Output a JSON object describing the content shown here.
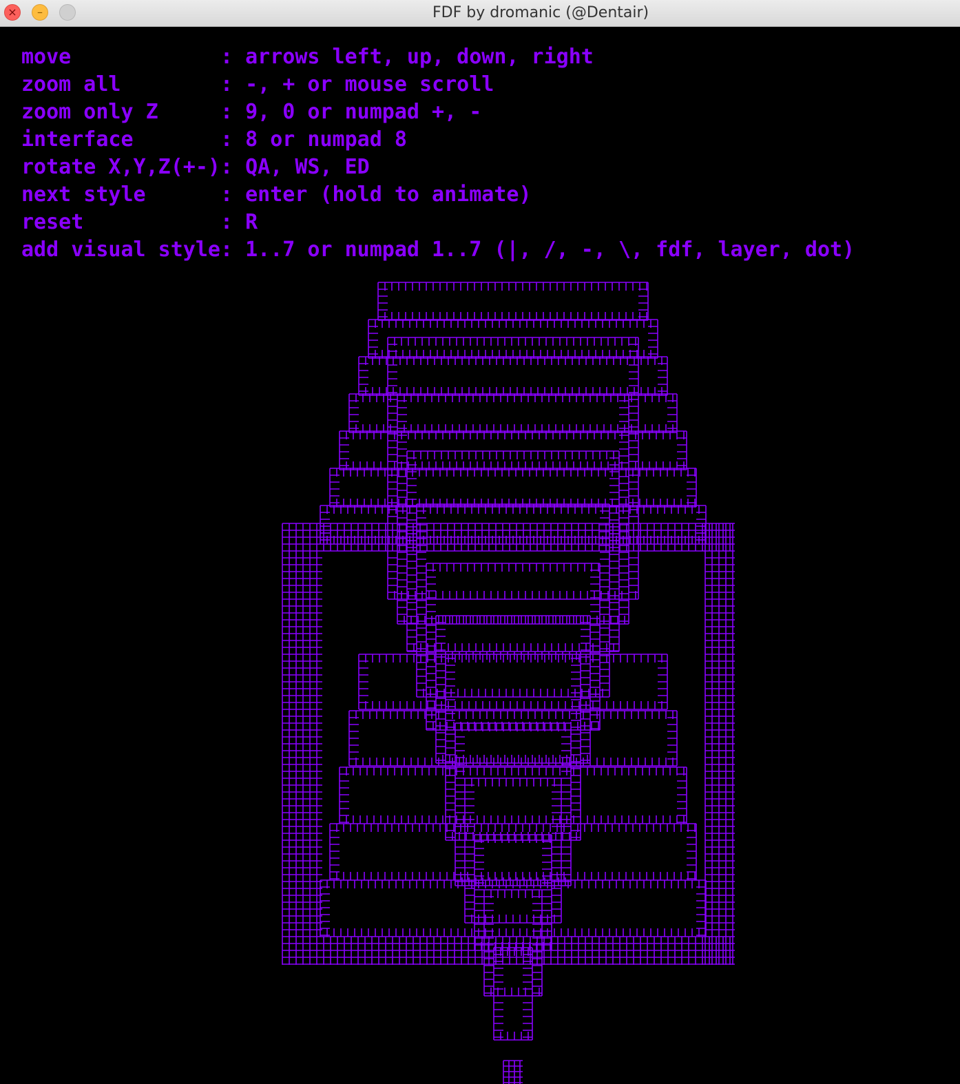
{
  "window": {
    "title": "FDF by dromanic (@Dentair)",
    "buttons": [
      "close",
      "minimize",
      "zoom"
    ]
  },
  "help": {
    "lines": [
      {
        "key": "move              ",
        "value": "arrows left, up, down, right"
      },
      {
        "key": "zoom all          ",
        "value": "-, + or mouse scroll"
      },
      {
        "key": "zoom only Z       ",
        "value": "9, 0 or numpad +, -"
      },
      {
        "key": "interface         ",
        "value": "8 or numpad 8"
      },
      {
        "key": "rotate X,Y,Z(+-)",
        "value": "QA, WS, ED"
      },
      {
        "key": "next style        ",
        "value": "enter (hold to animate)"
      },
      {
        "key": "reset             ",
        "value": "R"
      },
      {
        "key": "add visual style",
        "value": "1..7 or numpad 1..7 (|, /, -, \\, fdf, layer, dot)"
      }
    ],
    "text": [
      "move            : arrows left, up, down, right",
      "zoom all        : -, + or mouse scroll",
      "zoom only Z     : 9, 0 or numpad +, -",
      "interface       : 8 or numpad 8",
      "rotate X,Y,Z(+-): QA, WS, ED",
      "next style      : enter (hold to animate)",
      "reset           : R",
      "add visual style: 1..7 or numpad 1..7 (|, /, -, \\, fdf, layer, dot)"
    ]
  },
  "colors": {
    "background": "#000000",
    "accent": "#8a00ff",
    "mesh": "#8a00ff"
  },
  "render": {
    "description_name": "wireframe-mesh",
    "style": "layer"
  }
}
